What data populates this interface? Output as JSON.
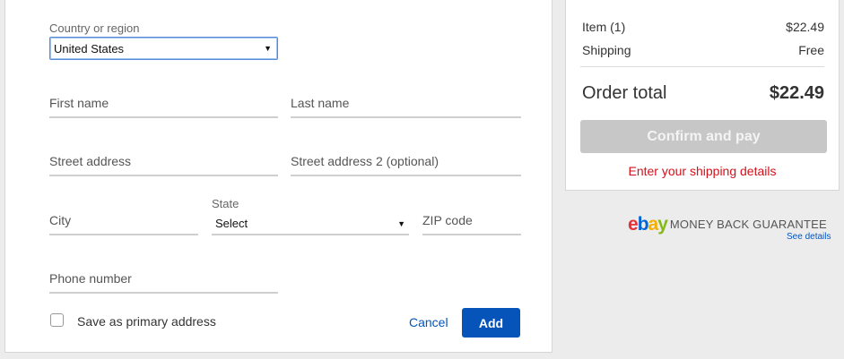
{
  "address_form": {
    "country_label": "Country or region",
    "country_value": "United States",
    "first_name_placeholder": "First name",
    "last_name_placeholder": "Last name",
    "street_placeholder": "Street address",
    "street2_placeholder": "Street address 2 (optional)",
    "city_placeholder": "City",
    "state_label": "State",
    "state_value": "Select",
    "zip_placeholder": "ZIP code",
    "phone_placeholder": "Phone number",
    "primary_checkbox_label": "Save as primary address",
    "primary_checked": false,
    "cancel_label": "Cancel",
    "add_label": "Add"
  },
  "order_summary": {
    "item_label": "Item (1)",
    "item_price": "$22.49",
    "shipping_label": "Shipping",
    "shipping_value": "Free",
    "total_label": "Order total",
    "total_value": "$22.49",
    "confirm_label": "Confirm and pay",
    "warning": "Enter your shipping details"
  },
  "guarantee": {
    "logo_letters": [
      "e",
      "b",
      "a",
      "y"
    ],
    "logo_colors": [
      "#e53238",
      "#0064d2",
      "#f5af02",
      "#86b817"
    ],
    "text": "MONEY BACK GUARANTEE",
    "link": "See details"
  },
  "colors": {
    "accent": "#0654ba",
    "warning": "#d4111b",
    "disabled_button": "#c7c7c7"
  }
}
